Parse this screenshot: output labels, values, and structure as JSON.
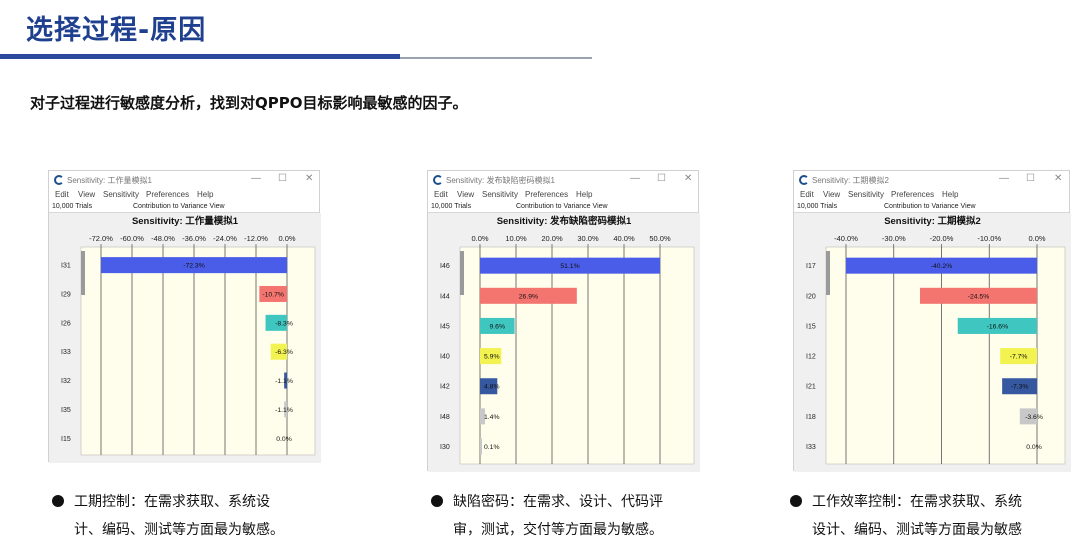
{
  "header": {
    "title": "选择过程-原因",
    "subtitle": "对子过程进行敏感度分析，找到对QPPO目标影响最敏感的因子。"
  },
  "window": {
    "menu": [
      "Edit",
      "View",
      "Sensitivity",
      "Preferences",
      "Help"
    ],
    "trials": "10,000 Trials",
    "view_label": "Contribution to Variance View",
    "controls": [
      "—",
      "☐",
      "✕"
    ]
  },
  "colors": {
    "plot_bg": "#fffdeb",
    "gridline": "#555555",
    "bar_blue": "#4a5de8",
    "bar_red": "#f47470",
    "bar_teal": "#3fc6c0",
    "bar_yellow": "#f2f250",
    "bar_navy": "#3558a0",
    "bar_gray": "#c8c8c8"
  },
  "windows": [
    {
      "window_title": "Sensitivity: 工作量模拟1"
    },
    {
      "window_title": "Sensitivity: 发布缺陷密码模拟1"
    },
    {
      "window_title": "Sensitivity: 工期模拟2"
    }
  ],
  "chart_data": [
    {
      "type": "bar",
      "orientation": "horizontal",
      "title": "Sensitivity: 工作量模拟1",
      "xlim": [
        -72,
        0
      ],
      "x_ticks": [
        "-72.0%",
        "-60.0%",
        "-48.0%",
        "-36.0%",
        "-24.0%",
        "-12.0%",
        "0.0%"
      ],
      "categories": [
        "I31",
        "I29",
        "I26",
        "I33",
        "I32",
        "I35",
        "I15"
      ],
      "values": [
        -72.3,
        -10.7,
        -8.3,
        -6.3,
        -1.1,
        -1.1,
        0.0
      ],
      "labels": [
        "-72.3%",
        "-10.7%",
        "-8.3%",
        "-6.3%",
        "-1.1%",
        "-1.1%",
        "0.0%"
      ],
      "colors": [
        "blue",
        "red",
        "teal",
        "yellow",
        "navy",
        "gray",
        "gray"
      ],
      "grid": true
    },
    {
      "type": "bar",
      "orientation": "horizontal",
      "title": "Sensitivity: 发布缺陷密码模拟1",
      "xlim": [
        0,
        50
      ],
      "x_ticks": [
        "0.0%",
        "10.0%",
        "20.0%",
        "30.0%",
        "40.0%",
        "50.0%"
      ],
      "categories": [
        "I46",
        "I44",
        "I45",
        "I40",
        "I42",
        "I48",
        "I30"
      ],
      "values": [
        51.1,
        26.9,
        9.6,
        5.9,
        4.8,
        1.4,
        0.1
      ],
      "labels": [
        "51.1%",
        "26.9%",
        "9.6%",
        "5.9%",
        "4.8%",
        "1.4%",
        "0.1%"
      ],
      "colors": [
        "blue",
        "red",
        "teal",
        "yellow",
        "navy",
        "gray",
        "gray"
      ],
      "grid": true
    },
    {
      "type": "bar",
      "orientation": "horizontal",
      "title": "Sensitivity: 工期模拟2",
      "xlim": [
        -40,
        0
      ],
      "x_ticks": [
        "-40.0%",
        "-30.0%",
        "-20.0%",
        "-10.0%",
        "0.0%"
      ],
      "categories": [
        "I17",
        "I20",
        "I15",
        "I12",
        "I21",
        "I18",
        "I33"
      ],
      "values": [
        -40.2,
        -24.5,
        -16.6,
        -7.7,
        -7.3,
        -3.6,
        0.0
      ],
      "labels": [
        "-40.2%",
        "-24.5%",
        "-16.6%",
        "-7.7%",
        "-7.3%",
        "-3.6%",
        "0.0%"
      ],
      "colors": [
        "blue",
        "red",
        "teal",
        "yellow",
        "navy",
        "gray",
        "gray"
      ],
      "grid": true
    }
  ],
  "bullets": [
    {
      "text": "工期控制：在需求获取、系统设\n计、编码、测试等方面最为敏感。"
    },
    {
      "text": "缺陷密码：在需求、设计、代码评\n审，测试，交付等方面最为敏感。"
    },
    {
      "text": "工作效率控制：在需求获取、系统\n设计、编码、测试等方面最为敏感"
    }
  ]
}
